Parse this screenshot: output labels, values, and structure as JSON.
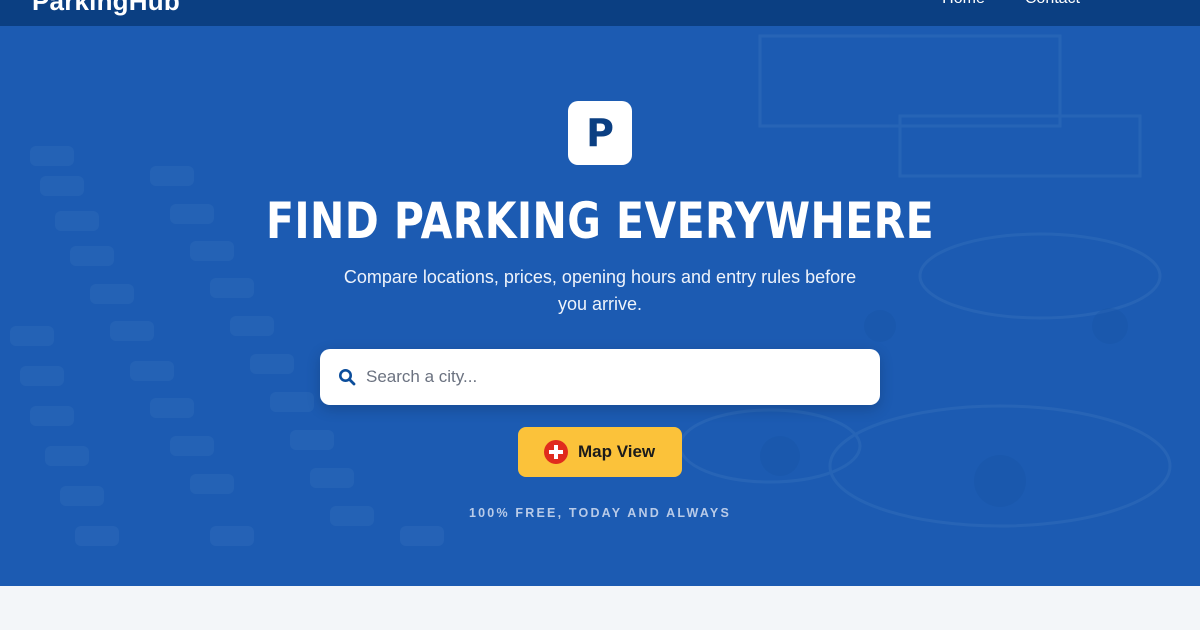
{
  "header": {
    "brand": "ParkingHub",
    "nav": [
      "Home",
      "Contact"
    ]
  },
  "hero": {
    "logo_letter": "P",
    "headline": "FIND PARKING EVERYWHERE",
    "subtext": "Compare locations, prices, opening hours and entry rules before you arrive.",
    "tagline": "100% FREE, TODAY AND ALWAYS"
  },
  "search": {
    "placeholder": "Search a city...",
    "value": ""
  },
  "map_button": {
    "label": "Map View",
    "icon": "swiss-cross-icon"
  },
  "colors": {
    "header_bg": "#0b3f82",
    "hero_overlay": "#1659b0",
    "accent": "#fbc23a",
    "page_bg": "#f3f6f9"
  }
}
